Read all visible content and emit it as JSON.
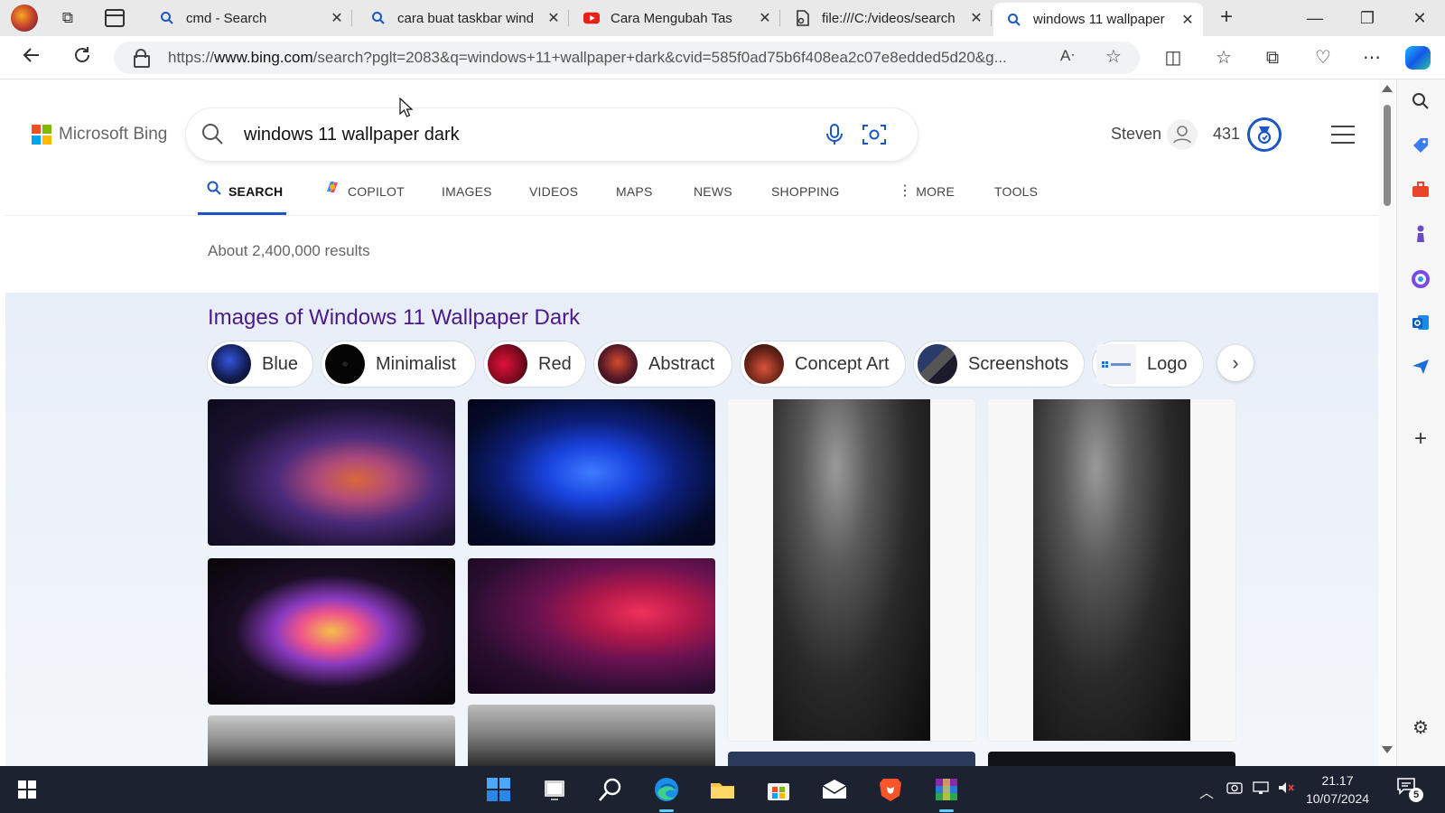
{
  "browser": {
    "tabs": [
      {
        "title": "cmd - Search",
        "icon": "bing-search-icon"
      },
      {
        "title": "cara buat taskbar wind",
        "icon": "bing-search-icon"
      },
      {
        "title": "Cara Mengubah Tas",
        "icon": "youtube-icon"
      },
      {
        "title": "file:///C:/videos/search",
        "icon": "pdf-file-icon"
      },
      {
        "title": "windows 11 wallpaper",
        "icon": "bing-search-icon",
        "active": true
      }
    ],
    "url_prefix": "https://",
    "url_host": "www.bing.com",
    "url_rest": "/search?pglt=2083&q=windows+11+wallpaper+dark&cvid=585f0ad75b6f408ea2c07e8edded5d20&g..."
  },
  "bing": {
    "logo_text": "Microsoft Bing",
    "query": "windows 11 wallpaper dark",
    "user_name": "Steven",
    "reward_points": "431",
    "scopes": [
      {
        "label": "SEARCH",
        "active": true
      },
      {
        "label": "COPILOT"
      },
      {
        "label": "IMAGES"
      },
      {
        "label": "VIDEOS"
      },
      {
        "label": "MAPS"
      },
      {
        "label": "NEWS"
      },
      {
        "label": "SHOPPING"
      },
      {
        "label": "MORE"
      },
      {
        "label": "TOOLS"
      }
    ],
    "results_count": "About 2,400,000 results",
    "images_title": "Images of Windows 11 Wallpaper Dark",
    "chips": [
      "Blue",
      "Minimalist",
      "Red",
      "Abstract",
      "Concept Art",
      "Screenshots",
      "Logo"
    ]
  },
  "taskbar": {
    "time": "21.17",
    "date": "10/07/2024",
    "notification_count": "5"
  },
  "colors": {
    "accent": "#1a56c4",
    "title_purple": "#4a1a8a",
    "taskbar_bg": "#1c2230"
  }
}
